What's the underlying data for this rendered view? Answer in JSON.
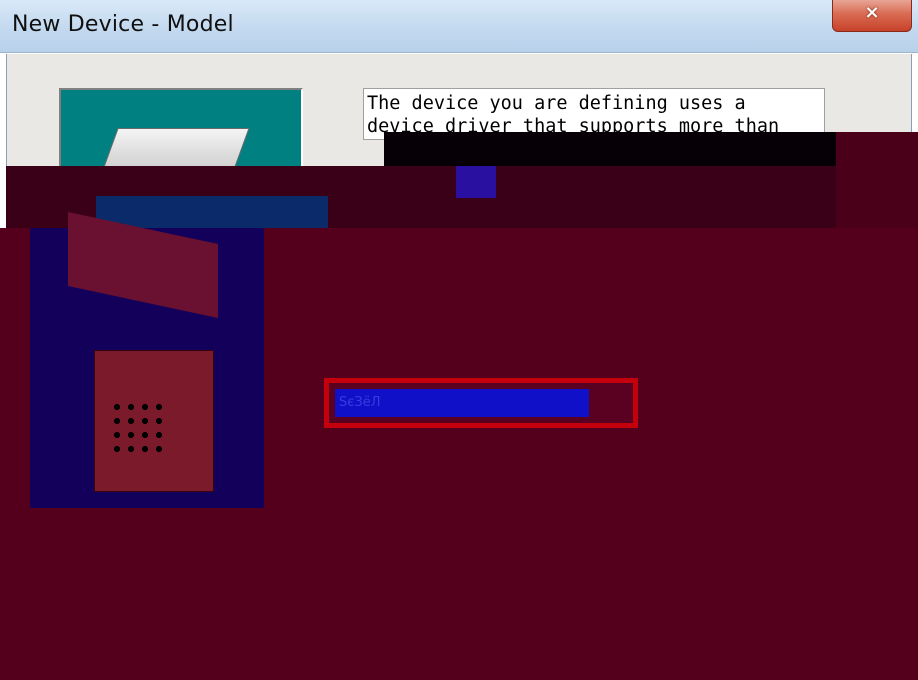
{
  "window": {
    "title": "New Device - Model",
    "close_icon": "×"
  },
  "description": {
    "text": "The device you are defining uses a device driver that supports more than"
  },
  "model_list": {
    "selected_item": "ЅєЗёЛ"
  },
  "colors": {
    "titlebar": "#c3d9ef",
    "close_button": "#d96b52",
    "client_background": "#e9e8e4",
    "wizard_image_background": "#008080",
    "glitch_background": "#54001c",
    "selection_highlight": "#1010c8",
    "selection_frame": "#c4000c"
  },
  "icons": {
    "close": "close-icon",
    "wizard_image": "device-wizard-image"
  }
}
